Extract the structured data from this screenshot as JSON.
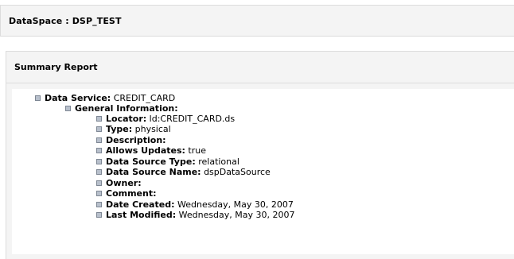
{
  "dataspace": {
    "label": "DataSpace :",
    "name": "DSP_TEST"
  },
  "summary": {
    "title": "Summary Report",
    "data_service": {
      "label": "Data Service:",
      "value": "CREDIT_CARD"
    },
    "general_information": {
      "label": "General Information:",
      "fields": [
        {
          "label": "Locator:",
          "value": "ld:CREDIT_CARD.ds"
        },
        {
          "label": "Type:",
          "value": "physical"
        },
        {
          "label": "Description:",
          "value": ""
        },
        {
          "label": "Allows Updates:",
          "value": "true"
        },
        {
          "label": "Data Source Type:",
          "value": "relational"
        },
        {
          "label": "Data Source Name:",
          "value": "dspDataSource"
        },
        {
          "label": "Owner:",
          "value": ""
        },
        {
          "label": "Comment:",
          "value": ""
        },
        {
          "label": "Date Created:",
          "value": "Wednesday, May 30, 2007"
        },
        {
          "label": "Last Modified:",
          "value": "Wednesday, May 30, 2007"
        }
      ]
    }
  },
  "colors": {
    "panel_bg": "#f4f4f4",
    "panel_border": "#dcdcdc",
    "bullet_fill": "#b8c0cc"
  },
  "icons": {
    "tree_bullet": "square-bullet-icon"
  }
}
